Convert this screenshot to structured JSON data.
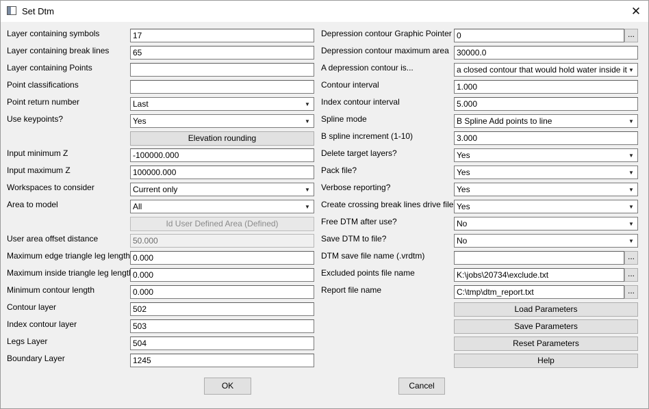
{
  "window": {
    "title": "Set Dtm",
    "close_glyph": "✕"
  },
  "left": {
    "symbols_layer": {
      "label": "Layer containing symbols",
      "value": "17"
    },
    "break_lines_layer": {
      "label": "Layer containing break lines",
      "value": "65"
    },
    "points_layer": {
      "label": "Layer containing Points",
      "value": ""
    },
    "point_classifications": {
      "label": "Point classifications",
      "value": ""
    },
    "point_return": {
      "label": "Point return number",
      "value": "Last"
    },
    "use_keypoints": {
      "label": "Use keypoints?",
      "value": "Yes"
    },
    "elevation_rounding_button": "Elevation rounding",
    "input_min_z": {
      "label": "Input minimum Z",
      "value": "-100000.000"
    },
    "input_max_z": {
      "label": "Input maximum Z",
      "value": "100000.000"
    },
    "workspaces": {
      "label": "Workspaces to consider",
      "value": "Current only"
    },
    "area_to_model": {
      "label": "Area to model",
      "value": "All"
    },
    "id_user_area_button": "Id User Defined Area (Defined)",
    "user_area_offset": {
      "label": "User area offset distance",
      "value": "50.000"
    },
    "max_edge_leg": {
      "label": "Maximum edge triangle leg length",
      "value": "0.000"
    },
    "max_inside_leg": {
      "label": "Maximum inside triangle leg length",
      "value": "0.000"
    },
    "min_contour_length": {
      "label": "Minimum contour length",
      "value": "0.000"
    },
    "contour_layer": {
      "label": "Contour layer",
      "value": "502"
    },
    "index_contour_layer": {
      "label": "Index contour layer",
      "value": "503"
    },
    "legs_layer": {
      "label": "Legs Layer",
      "value": "504"
    },
    "boundary_layer": {
      "label": "Boundary Layer",
      "value": "1245"
    }
  },
  "right": {
    "depression_pointer": {
      "label": "Depression contour Graphic Pointer",
      "value": "0"
    },
    "depression_max_area": {
      "label": "Depression contour maximum area",
      "value": "30000.0"
    },
    "depression_is": {
      "label": "A depression contour is...",
      "value": "a closed contour that would hold water inside it"
    },
    "contour_interval": {
      "label": "Contour interval",
      "value": "1.000"
    },
    "index_contour_interval": {
      "label": "Index contour interval",
      "value": "5.000"
    },
    "spline_mode": {
      "label": "Spline mode",
      "value": "B Spline Add points to line"
    },
    "b_spline_increment": {
      "label": "B spline increment (1-10)",
      "value": "3.000"
    },
    "delete_target": {
      "label": "Delete target layers?",
      "value": "Yes"
    },
    "pack_file": {
      "label": "Pack file?",
      "value": "Yes"
    },
    "verbose": {
      "label": "Verbose reporting?",
      "value": "Yes"
    },
    "crossing_break": {
      "label": "Create crossing break lines drive file?",
      "value": "Yes"
    },
    "free_dtm": {
      "label": "Free DTM after use?",
      "value": "No"
    },
    "save_dtm": {
      "label": "Save DTM to file?",
      "value": "No"
    },
    "dtm_save_name": {
      "label": "DTM save file name (.vrdtm)",
      "value": ""
    },
    "excluded_points": {
      "label": "Excluded points file name",
      "value": "K:\\jobs\\20734\\exclude.txt"
    },
    "report_file": {
      "label": "Report file name",
      "value": "C:\\tmp\\dtm_report.txt"
    },
    "browse_label": "...",
    "load_button": "Load Parameters",
    "save_button": "Save Parameters",
    "reset_button": "Reset Parameters",
    "help_button": "Help"
  },
  "footer": {
    "ok": "OK",
    "cancel": "Cancel"
  },
  "icons": {
    "dropdown": "chevron-down-icon",
    "app": "window-app-icon",
    "close": "close-icon"
  }
}
